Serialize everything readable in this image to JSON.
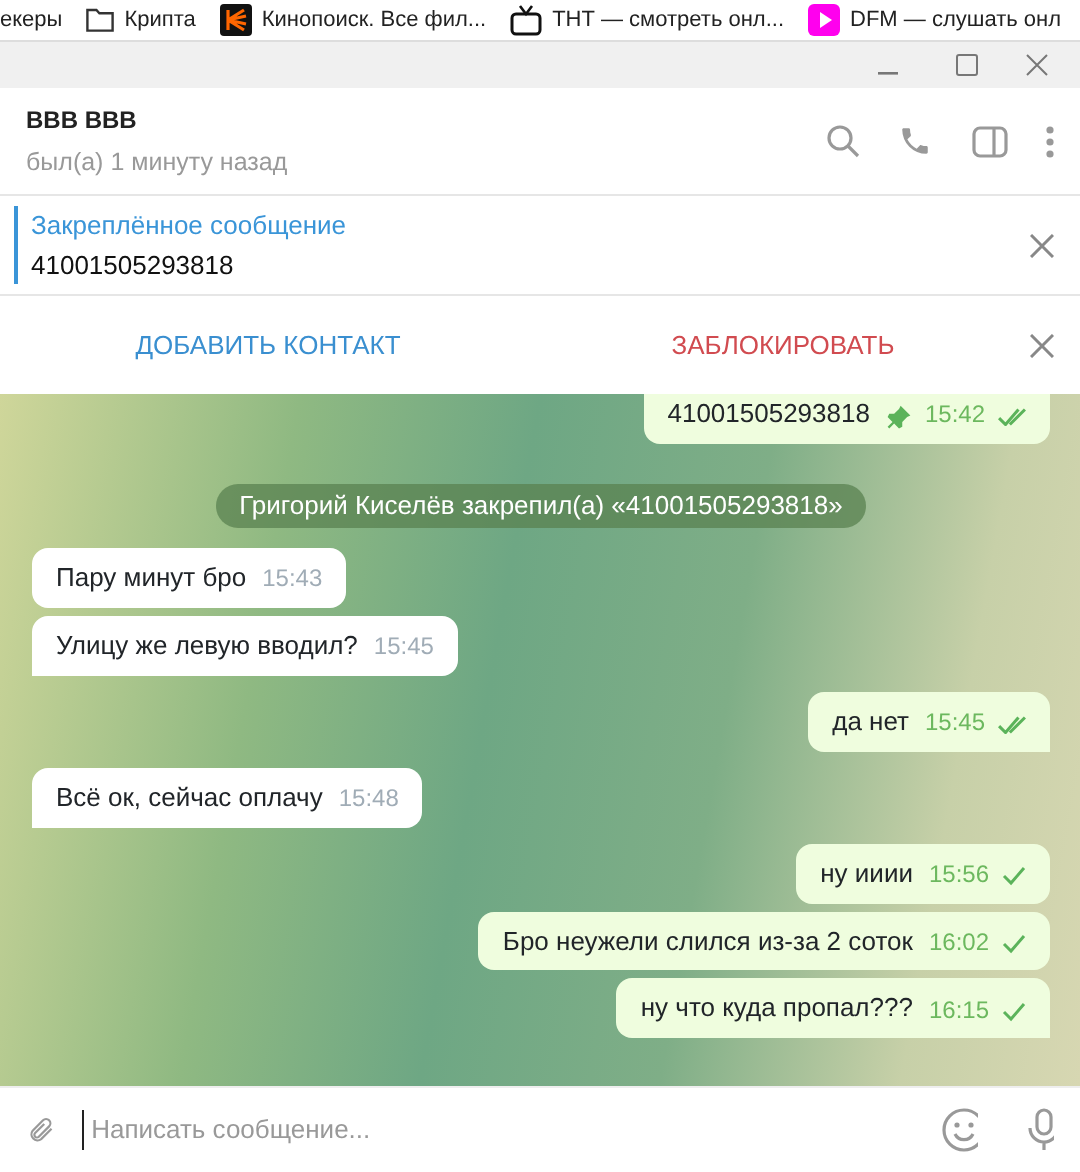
{
  "bookmarks": [
    {
      "kind": "text",
      "label": "екеры"
    },
    {
      "kind": "folder",
      "label": "Крипта"
    },
    {
      "kind": "kino",
      "label": "Кинопоиск. Все фил..."
    },
    {
      "kind": "tv",
      "label": "ТНТ — смотреть онл..."
    },
    {
      "kind": "play",
      "label": "DFM — слушать онл"
    }
  ],
  "chat_header": {
    "name": "BBB BBB",
    "status": "был(а) 1 минуту назад"
  },
  "pinned": {
    "title": "Закреплённое сообщение",
    "text": "41001505293818"
  },
  "action_bar": {
    "add_contact": "ДОБАВИТЬ КОНТАКТ",
    "block": "ЗАБЛОКИРОВАТЬ"
  },
  "messages": [
    {
      "kind": "out",
      "text": "41001505293818",
      "time": "15:42",
      "pinned": true,
      "read": true,
      "tail": false
    },
    {
      "kind": "service",
      "text": "Григорий Киселёв закрепил(а) «41001505293818»"
    },
    {
      "kind": "in",
      "text": "Пару минут бро",
      "time": "15:43",
      "tail": false
    },
    {
      "kind": "in",
      "text": "Улицу же левую вводил?",
      "time": "15:45",
      "tail": true
    },
    {
      "kind": "out",
      "text": "да нет",
      "time": "15:45",
      "pinned": false,
      "read": true,
      "tail": true
    },
    {
      "kind": "in",
      "text": "Всё ок, сейчас оплачу",
      "time": "15:48",
      "tail": true
    },
    {
      "kind": "out",
      "text": "ну ииии",
      "time": "15:56",
      "pinned": false,
      "read": false,
      "tail": false
    },
    {
      "kind": "out",
      "text": "Бро неужели слился из-за 2 соток",
      "time": "16:02",
      "pinned": false,
      "read": false,
      "tail": false
    },
    {
      "kind": "out",
      "text": "ну что куда пропал???",
      "time": "16:15",
      "pinned": false,
      "read": false,
      "tail": true
    }
  ],
  "composer": {
    "placeholder": "Написать сообщение..."
  }
}
